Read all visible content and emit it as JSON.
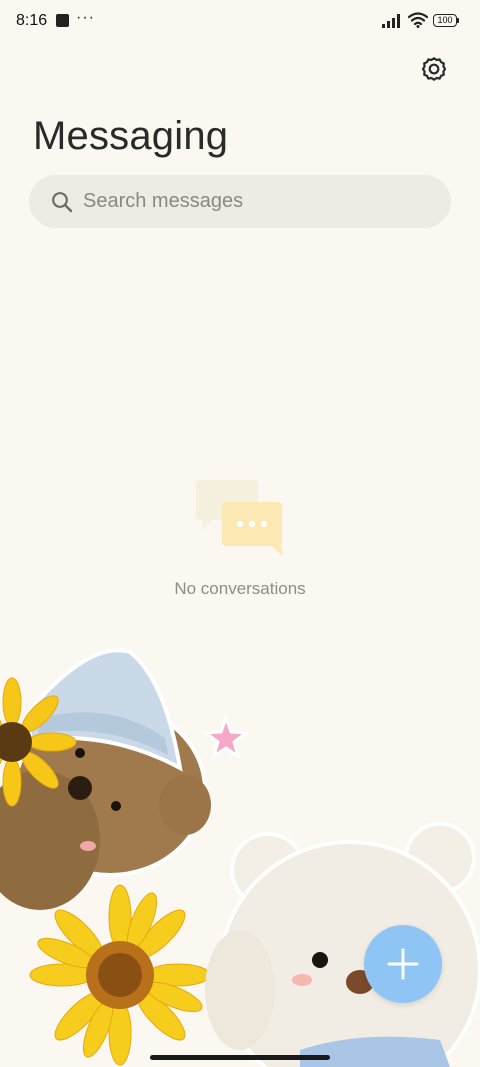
{
  "status_bar": {
    "time": "8:16",
    "battery": "100",
    "notification_dots": "···",
    "icons": [
      "notification-square-icon",
      "signal-icon",
      "wifi-icon",
      "battery-icon"
    ]
  },
  "header": {
    "title": "Messaging",
    "settings_icon": "gear-icon"
  },
  "search": {
    "placeholder": "Search messages",
    "value": "",
    "icon": "search-icon"
  },
  "empty_state": {
    "icon": "chat-bubbles-icon",
    "text": "No conversations"
  },
  "fab": {
    "icon": "plus-icon",
    "color": "#8ec5f5"
  },
  "theme": {
    "background": "#faf8f1",
    "search_background": "#edebe4",
    "accent": "#8ec5f5",
    "empty_icon_color": "#fbe9b5"
  }
}
